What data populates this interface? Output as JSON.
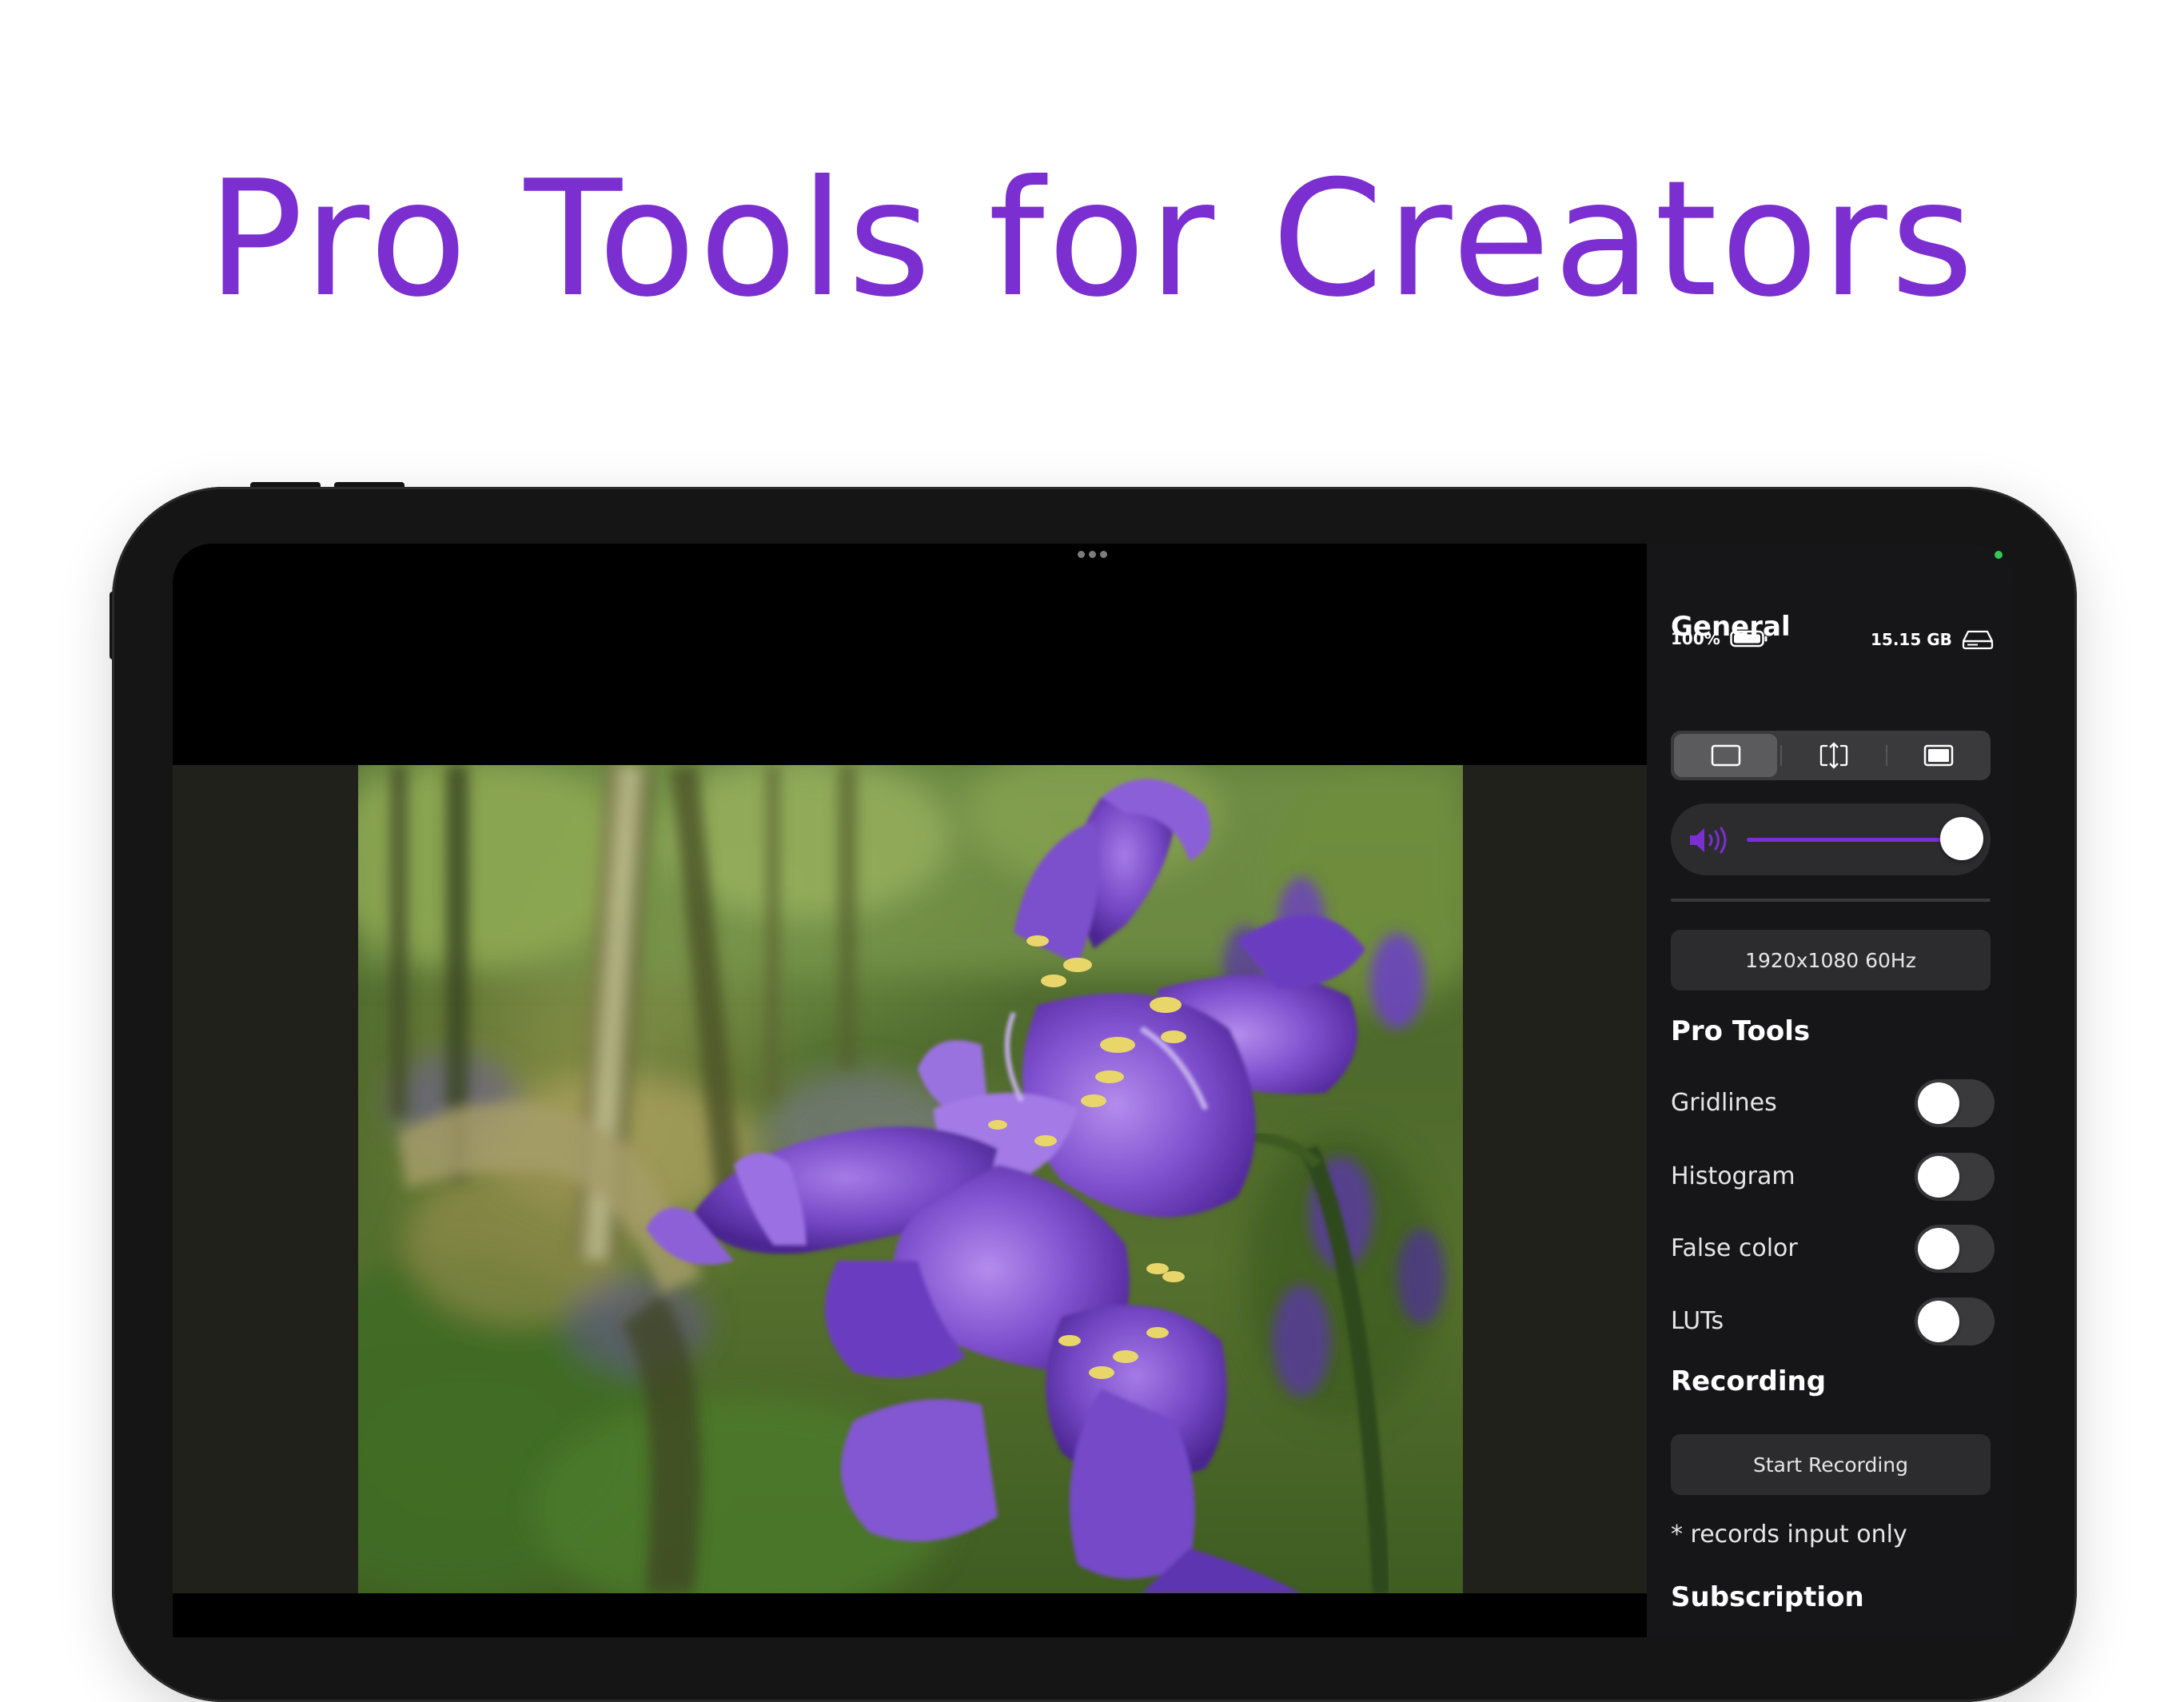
{
  "headline": "Pro Tools for Creators",
  "colors": {
    "accent": "#7b2fd0",
    "camera_indicator": "#34c759",
    "sidebar_bg": "#161618",
    "control_bg": "#2c2c2e"
  },
  "sidebar": {
    "general_title": "General",
    "battery_label": "100%",
    "storage_label": "15.15 GB",
    "display_modes": {
      "icons": [
        "display-fit-icon",
        "display-fill-icon",
        "display-stretch-icon"
      ],
      "selected_index": 0
    },
    "volume": {
      "icon": "speaker-volume-icon",
      "level": 1.0
    },
    "resolution_label": "1920x1080 60Hz",
    "pro_tools_title": "Pro Tools",
    "toggles": [
      {
        "label": "Gridlines",
        "on": false
      },
      {
        "label": "Histogram",
        "on": false
      },
      {
        "label": "False color",
        "on": false
      },
      {
        "label": "LUTs",
        "on": false
      }
    ],
    "recording_title": "Recording",
    "start_recording_label": "Start Recording",
    "recording_note": "* records input only",
    "subscription_title": "Subscription"
  }
}
